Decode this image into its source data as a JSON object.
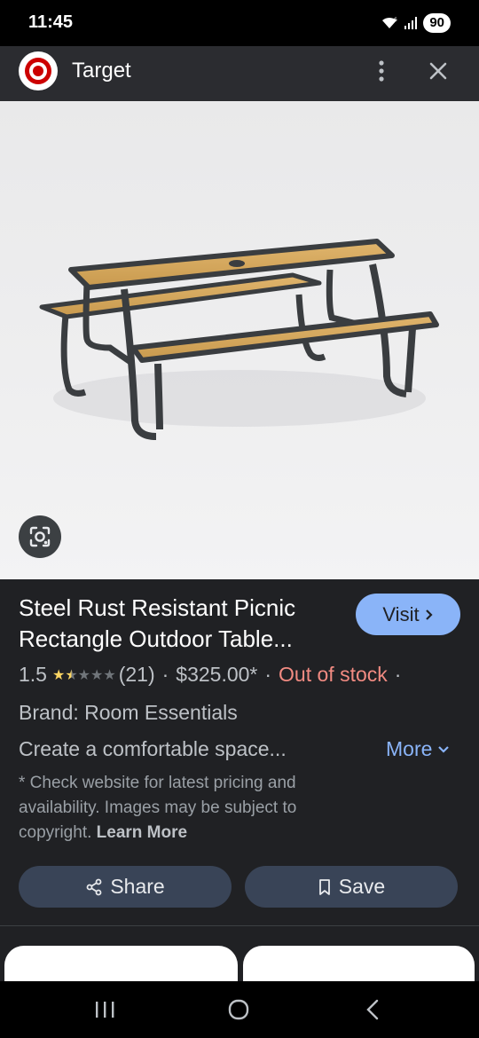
{
  "status_bar": {
    "time": "11:45",
    "battery": "90"
  },
  "header": {
    "title": "Target"
  },
  "product": {
    "title": "Steel Rust Resistant Picnic Rectangle Outdoor Table...",
    "rating": "1.5",
    "rating_value": 1.5,
    "review_count": "(21)",
    "price": "$325.00*",
    "stock_status": "Out of stock",
    "brand": "Brand: Room Essentials",
    "description": "Create a comfortable space...",
    "more_label": "More",
    "visit_label": "Visit",
    "disclaimer": "* Check website for latest pricing and availability. Images may be subject to copyright.",
    "learn_more": "Learn More"
  },
  "actions": {
    "share_label": "Share",
    "save_label": "Save"
  },
  "colors": {
    "accent_blue": "#8ab4f8",
    "out_of_stock": "#f28b82",
    "star_gold": "#fdd663",
    "button_bg": "#394457",
    "target_red": "#cc0000"
  }
}
